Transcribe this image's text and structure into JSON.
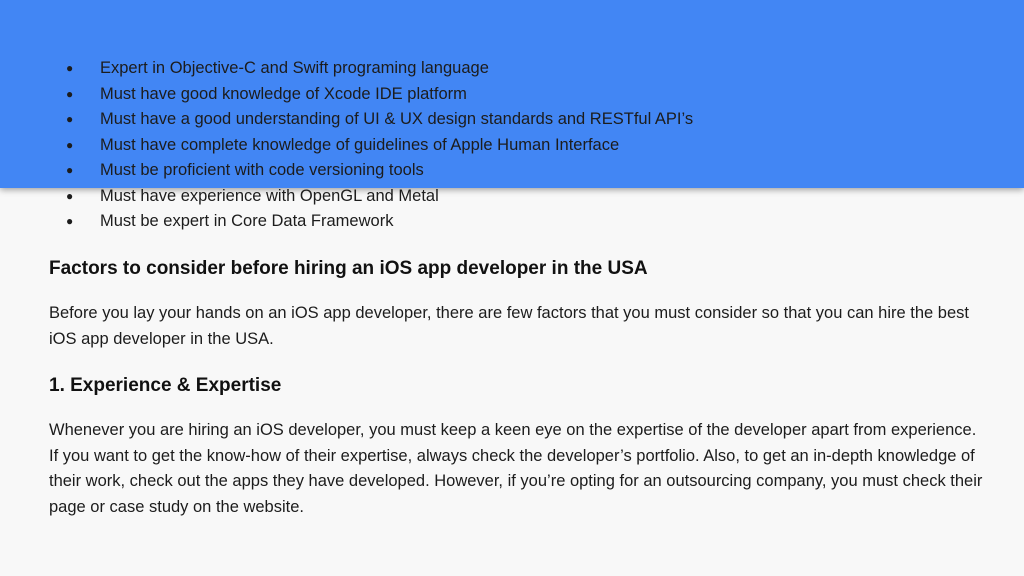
{
  "colors": {
    "header_band": "#4286f4",
    "background": "#f8f8f8"
  },
  "requirements": [
    "Expert in Objective-C and Swift programing language",
    "Must have good knowledge of Xcode IDE platform",
    "Must have a good understanding of UI & UX design standards and RESTful API’s",
    "Must have complete knowledge of guidelines of Apple Human Interface",
    "Must be proficient with code versioning tools",
    "Must have experience with OpenGL and Metal",
    "Must be expert in Core Data Framework"
  ],
  "bullet_glyph": "●",
  "section1": {
    "heading": "Factors to consider before hiring an iOS app developer in the USA",
    "body": "Before you lay your hands on an iOS app developer, there are few factors that you must consider so that you can hire the best iOS app developer in the USA."
  },
  "section2": {
    "heading": "1. Experience & Expertise",
    "body": "Whenever you are hiring an iOS developer, you must keep a keen eye on the expertise of the developer apart from experience. If you want to get the know-how of their expertise, always check the developer’s portfolio. Also, to get an in-depth knowledge of their work, check out the apps they have developed. However, if you’re opting for an outsourcing company, you must check their page or case study on the website."
  }
}
